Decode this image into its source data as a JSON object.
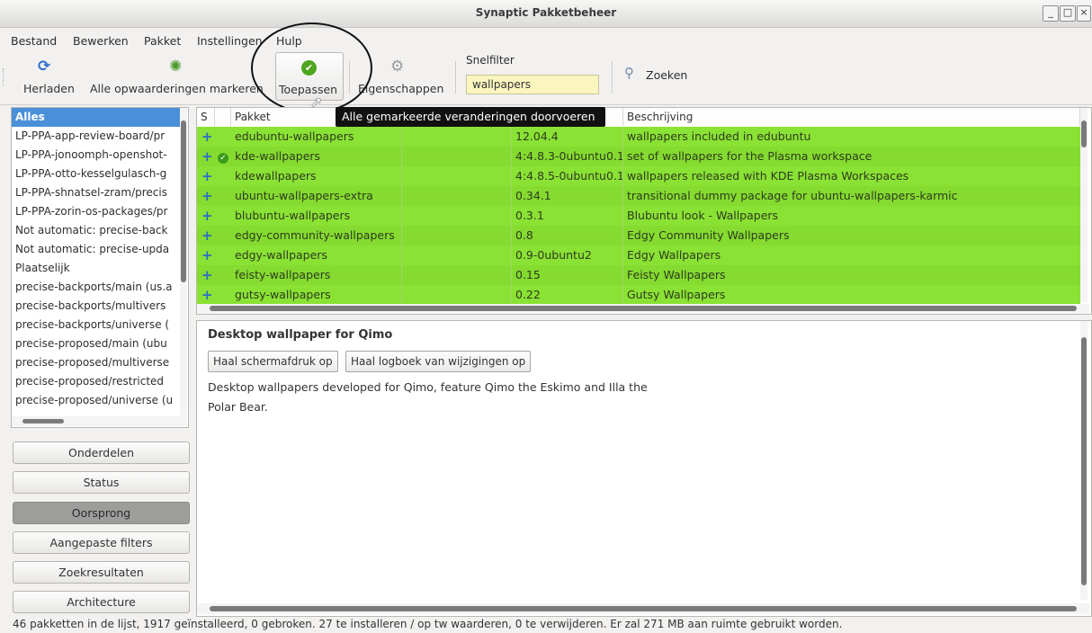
{
  "window": {
    "title": "Synaptic Pakketbeheer",
    "btn_min": "_",
    "btn_max": "□",
    "btn_close": "×"
  },
  "menu": [
    "Bestand",
    "Bewerken",
    "Pakket",
    "Instellingen",
    "Hulp"
  ],
  "toolbar": {
    "reload": "Herladen",
    "mark_all": "Alle opwaarderingen markeren",
    "apply": "Toepassen",
    "properties": "Eigenschappen",
    "quickfilter_label": "Snelfilter",
    "quickfilter_value": "wallpapers",
    "search": "Zoeken"
  },
  "sources": [
    "Alles",
    "LP-PPA-app-review-board/pr",
    "LP-PPA-jonoomph-openshot-",
    "LP-PPA-otto-kesselgulasch-g",
    "LP-PPA-shnatsel-zram/precis",
    "LP-PPA-zorin-os-packages/pr",
    "Not automatic: precise-back",
    "Not automatic: precise-upda",
    "Plaatselijk",
    "precise-backports/main (us.a",
    "precise-backports/multivers",
    "precise-backports/universe (",
    "precise-proposed/main (ubu",
    "precise-proposed/multiverse",
    "precise-proposed/restricted",
    "precise-proposed/universe (u"
  ],
  "filter_buttons": [
    "Onderdelen",
    "Status",
    "Oorsprong",
    "Aangepaste filters",
    "Zoekresultaten",
    "Architecture"
  ],
  "table": {
    "headers": [
      "S",
      "Pakket",
      "Beschrijving"
    ],
    "rows": [
      {
        "status": "+",
        "pkg": "edubuntu-wallpapers",
        "version": "12.04.4",
        "desc": "wallpapers included in edubuntu",
        "installed": false
      },
      {
        "status": "+",
        "pkg": "kde-wallpapers",
        "version": "4:4.8.3-0ubuntu0.1",
        "desc": "set of wallpapers for the Plasma workspace",
        "installed": true
      },
      {
        "status": "+",
        "pkg": "kdewallpapers",
        "version": "4:4.8.5-0ubuntu0.1",
        "desc": "wallpapers released with KDE Plasma Workspaces",
        "installed": false
      },
      {
        "status": "+",
        "pkg": "ubuntu-wallpapers-extra",
        "version": "0.34.1",
        "desc": "transitional dummy package for ubuntu-wallpapers-karmic",
        "installed": false
      },
      {
        "status": "+",
        "pkg": "blubuntu-wallpapers",
        "version": "0.3.1",
        "desc": "Blubuntu look - Wallpapers",
        "installed": false
      },
      {
        "status": "+",
        "pkg": "edgy-community-wallpapers",
        "version": "0.8",
        "desc": "Edgy Community Wallpapers",
        "installed": false
      },
      {
        "status": "+",
        "pkg": "edgy-wallpapers",
        "version": "0.9-0ubuntu2",
        "desc": "Edgy Wallpapers",
        "installed": false
      },
      {
        "status": "+",
        "pkg": "feisty-wallpapers",
        "version": "0.15",
        "desc": "Feisty Wallpapers",
        "installed": false
      },
      {
        "status": "+",
        "pkg": "gutsy-wallpapers",
        "version": "0.22",
        "desc": "Gutsy Wallpapers",
        "installed": false
      }
    ]
  },
  "tooltip": "Alle gemarkeerde veranderingen doorvoeren",
  "details": {
    "title": "Desktop wallpaper for Qimo",
    "btn_screenshot": "Haal schermafdruk op",
    "btn_changelog": "Haal logboek van wijzigingen op",
    "line1": "Desktop wallpapers developed for Qimo, feature Qimo the Eskimo and Illa the",
    "line2": "Polar Bear."
  },
  "statusbar": "46 pakketten in de lijst, 1917 geïnstalleerd, 0 gebroken. 27 te installeren / op tw waarderen, 0 te verwijderen. Er zal 271 MB aan ruimte gebruikt worden.",
  "colors": {
    "row_green": "#8ae234",
    "selection_blue": "#4a90d9",
    "filter_yellow": "#fbf6bf"
  }
}
